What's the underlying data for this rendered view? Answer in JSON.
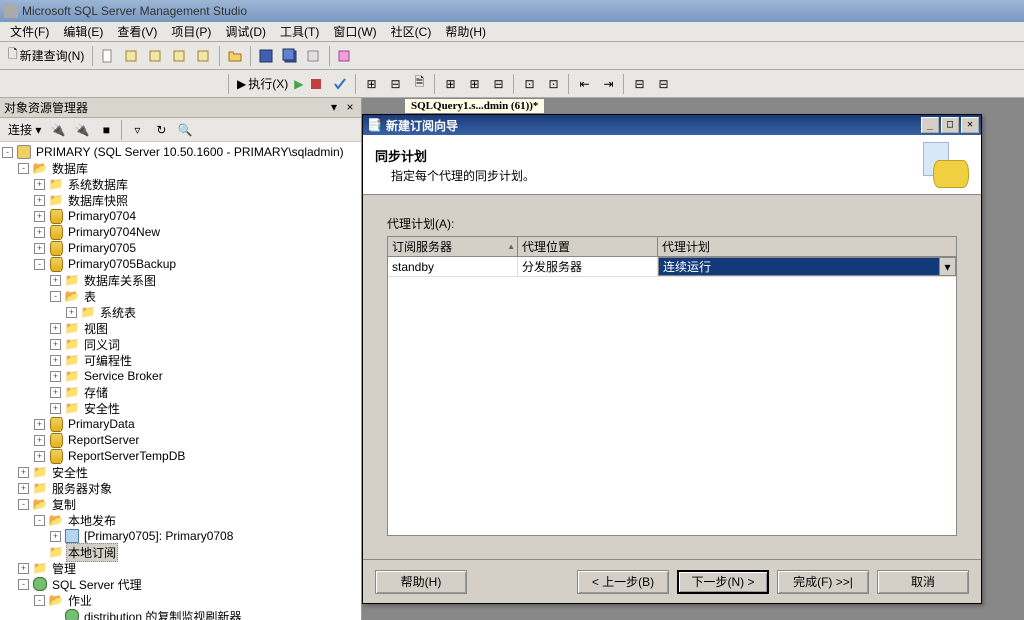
{
  "app_title": "Microsoft SQL Server Management Studio",
  "menu": {
    "file": "文件(F)",
    "edit": "编辑(E)",
    "view": "查看(V)",
    "project": "项目(P)",
    "debug": "调试(D)",
    "tools": "工具(T)",
    "window": "窗口(W)",
    "community": "社区(C)",
    "help": "帮助(H)"
  },
  "toolbar": {
    "new_query": "新建查询(N)",
    "execute": "执行(X)"
  },
  "explorer": {
    "title": "对象资源管理器",
    "connect": "连接 ▾",
    "root": "PRIMARY (SQL Server 10.50.1600 - PRIMARY\\sqladmin)",
    "databases": "数据库",
    "sysdb": "系统数据库",
    "dbsnap": "数据库快照",
    "db1": "Primary0704",
    "db2": "Primary0704New",
    "db3": "Primary0705",
    "db4": "Primary0705Backup",
    "diagram": "数据库关系图",
    "tables": "表",
    "systables": "系统表",
    "views": "视图",
    "synonyms": "同义词",
    "programmability": "可编程性",
    "servicebroker": "Service Broker",
    "storage": "存储",
    "dbsecurity": "安全性",
    "db5": "PrimaryData",
    "db6": "ReportServer",
    "db7": "ReportServerTempDB",
    "security": "安全性",
    "serverobjects": "服务器对象",
    "replication": "复制",
    "localpub": "本地发布",
    "pub1": "[Primary0705]: Primary0708",
    "localsub": "本地订阅",
    "management": "管理",
    "agent": "SQL Server 代理",
    "jobs": "作业",
    "job1": "distribution 的复制监视刷新器"
  },
  "tab": {
    "label": "SQLQuery1.s...dmin (61))*"
  },
  "wizard": {
    "title": "新建订阅向导",
    "heading": "同步计划",
    "subheading": "指定每个代理的同步计划。",
    "group_label": "代理计划(A):",
    "col1": "订阅服务器",
    "col2": "代理位置",
    "col3": "代理计划",
    "row": {
      "server": "standby",
      "location": "分发服务器",
      "plan": "连续运行"
    },
    "btn_help": "帮助(H)",
    "btn_back": "< 上一步(B)",
    "btn_next": "下一步(N) >",
    "btn_finish": "完成(F) >>|",
    "btn_cancel": "取消"
  }
}
